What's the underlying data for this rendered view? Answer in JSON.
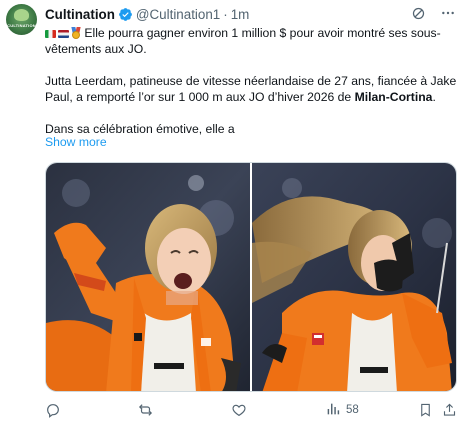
{
  "account": {
    "display_name": "Cultination",
    "handle": "@Cultination1",
    "separator": "·",
    "time": "1m",
    "avatar_text": "CULTINATION"
  },
  "tweet": {
    "line1": "Elle pourra gagner environ 1 million $ pour avoir montré ses sous-",
    "line2": "vêtements aux JO.",
    "para2_line1": "Jutta Leerdam, patineuse de vitesse néerlandaise de 27 ans, fiancée à Jake",
    "para2_line2_a": "Paul, a remporté l’or sur 1 000 m aux JO d’hiver 2026 de ",
    "para2_line2_bold": "Milan-Cortina",
    "para2_line2_end": ".",
    "para3": "Dans sa célébration émotive, elle a",
    "show_more": "Show more"
  },
  "actions": {
    "views_count": "58"
  },
  "colors": {
    "link": "#1d9bf0",
    "muted": "#536471",
    "verified": "#1d9bf0",
    "suit_orange": "#f07a1c"
  },
  "icons": [
    "verified-badge-icon",
    "grok-icon",
    "more-icon",
    "italy-flag-icon",
    "netherlands-flag-icon",
    "medal-icon",
    "reply-icon",
    "retweet-icon",
    "like-icon",
    "views-icon",
    "bookmark-icon",
    "share-icon"
  ]
}
